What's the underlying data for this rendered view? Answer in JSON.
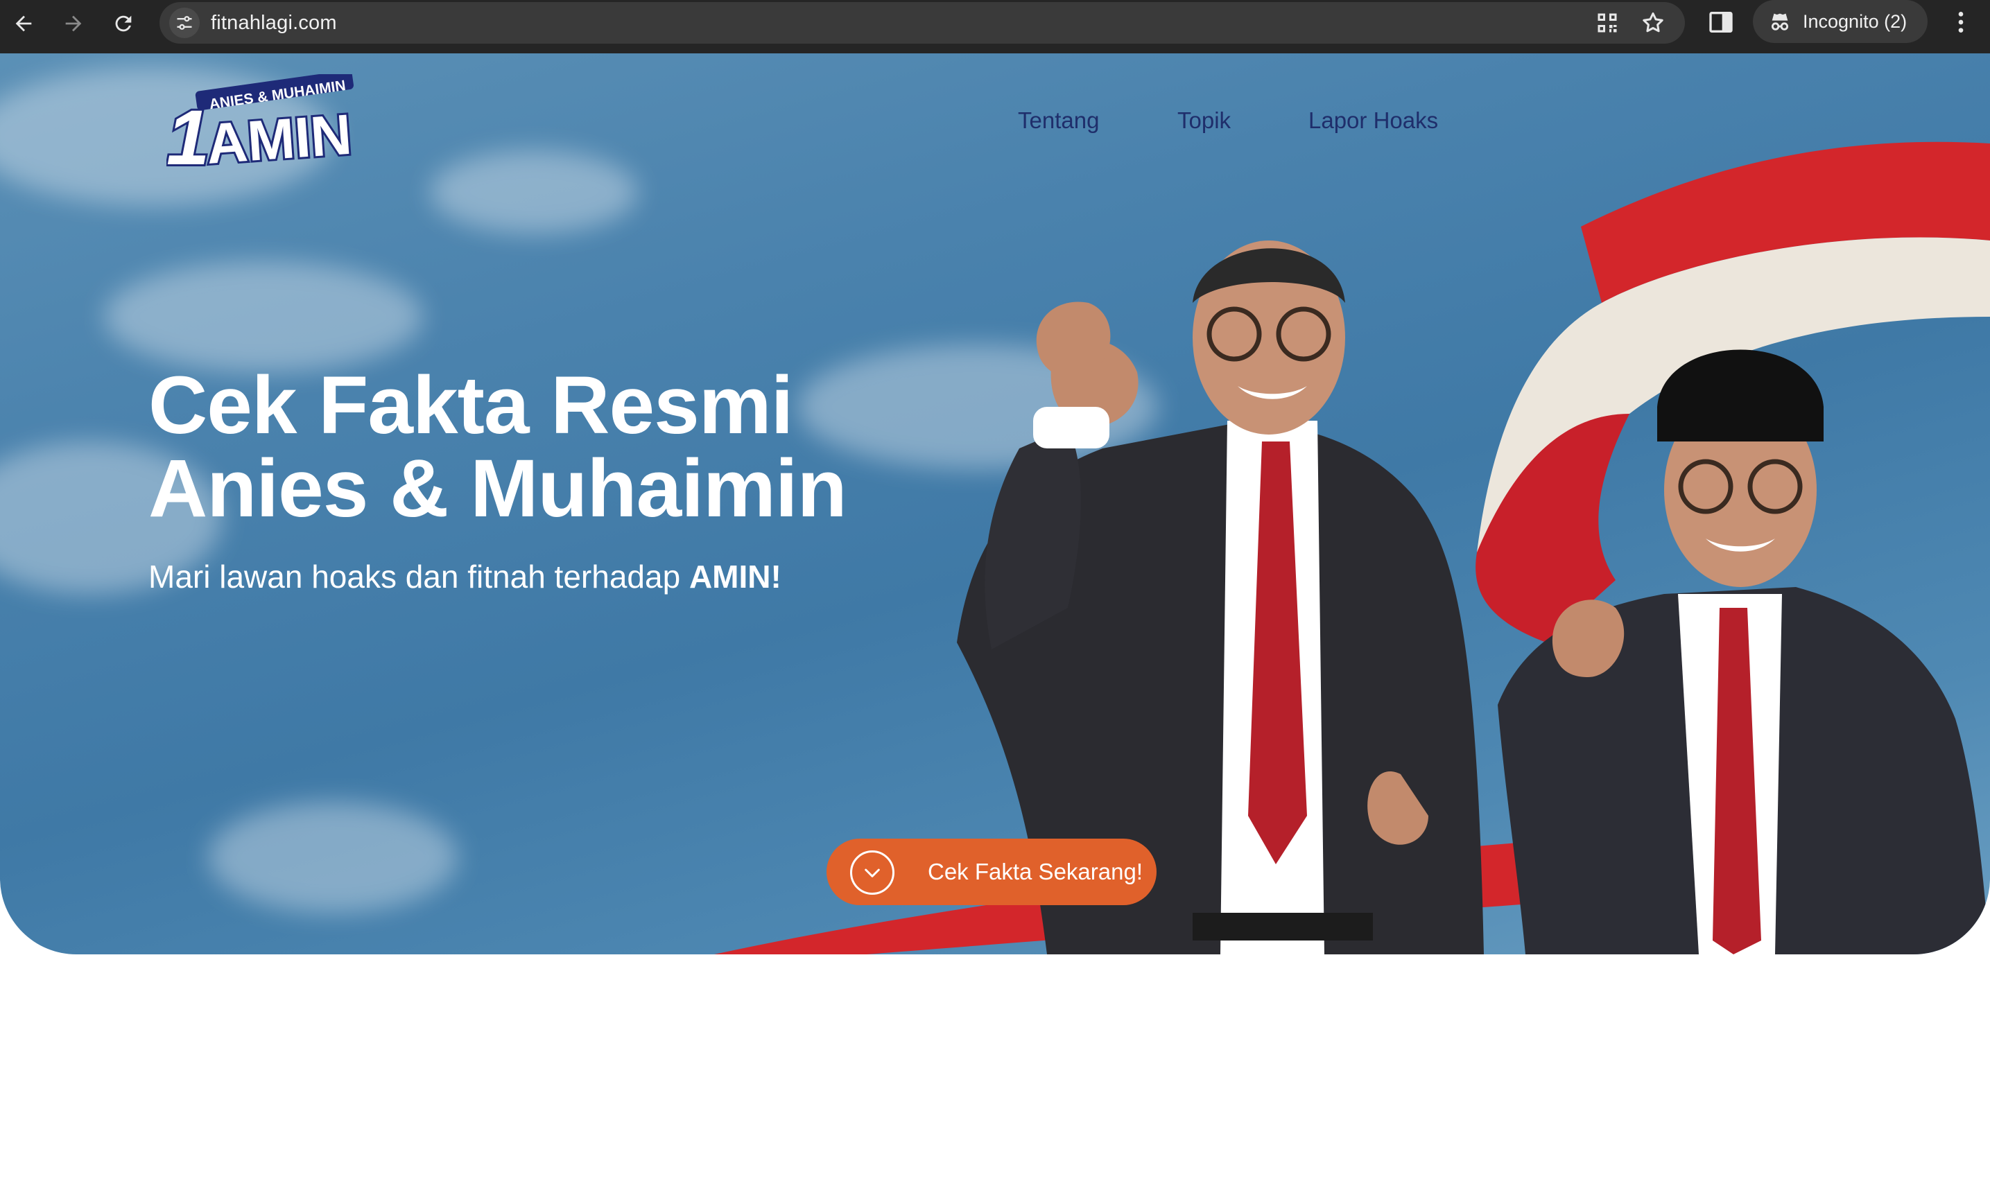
{
  "browser": {
    "url": "fitnahlagi.com",
    "incognito_label": "Incognito (2)",
    "icons": [
      "back-arrow-icon",
      "forward-arrow-icon",
      "reload-icon",
      "site-settings-icon",
      "qr-code-icon",
      "star-icon",
      "side-panel-icon",
      "incognito-icon",
      "kebab-menu-icon"
    ]
  },
  "site": {
    "logo": {
      "number": "1",
      "top_text": "ANIES & MUHAIMIN",
      "word": "AMIN"
    },
    "nav": [
      {
        "label": "Tentang"
      },
      {
        "label": "Topik"
      },
      {
        "label": "Lapor Hoaks"
      }
    ],
    "hero": {
      "title_line1": "Cek Fakta Resmi",
      "title_line2": "Anies & Muhaimin",
      "subtitle_prefix": "Mari lawan hoaks dan fitnah terhadap ",
      "subtitle_bold": "AMIN!",
      "cta_label": "Cek Fakta Sekarang!",
      "cta_icon": "chevron-down-circle-icon"
    }
  },
  "colors": {
    "chrome_bg": "#252525",
    "omnibox_bg": "#3a3a3a",
    "sky": "#4a82ad",
    "nav_text": "#1f2e6b",
    "cta": "#e0612b",
    "flag_red": "#d3262b",
    "suit": "#2b2b30",
    "tie": "#b5202a"
  }
}
